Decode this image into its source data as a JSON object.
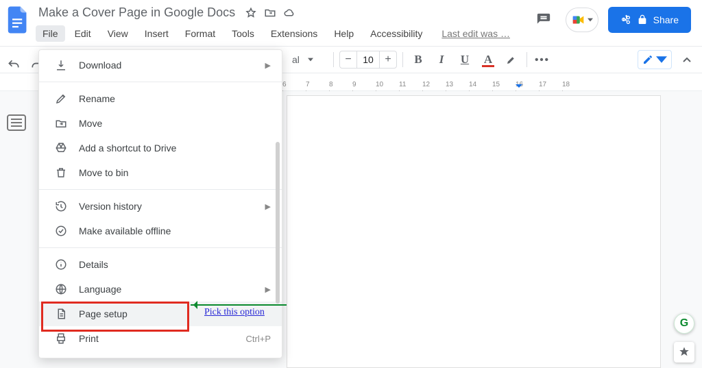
{
  "doc": {
    "title": "Make a Cover Page in Google Docs"
  },
  "menubar": {
    "file": "File",
    "edit": "Edit",
    "view": "View",
    "insert": "Insert",
    "format": "Format",
    "tools": "Tools",
    "extensions": "Extensions",
    "help": "Help",
    "accessibility": "Accessibility",
    "last_edit": "Last edit was …"
  },
  "share": {
    "label": "Share"
  },
  "toolbar": {
    "font_partial": "al",
    "font_size": "10"
  },
  "file_menu": {
    "download": "Download",
    "rename": "Rename",
    "move": "Move",
    "shortcut": "Add a shortcut to Drive",
    "bin": "Move to bin",
    "version": "Version history",
    "offline": "Make available offline",
    "details": "Details",
    "language": "Language",
    "pagesetup": "Page setup",
    "print": "Print",
    "print_shortcut": "Ctrl+P"
  },
  "ruler": {
    "ticks": [
      "6",
      "7",
      "8",
      "9",
      "10",
      "11",
      "12",
      "13",
      "14",
      "15",
      "16",
      "17",
      "18"
    ]
  },
  "annotation": {
    "text": "Pick this option"
  }
}
